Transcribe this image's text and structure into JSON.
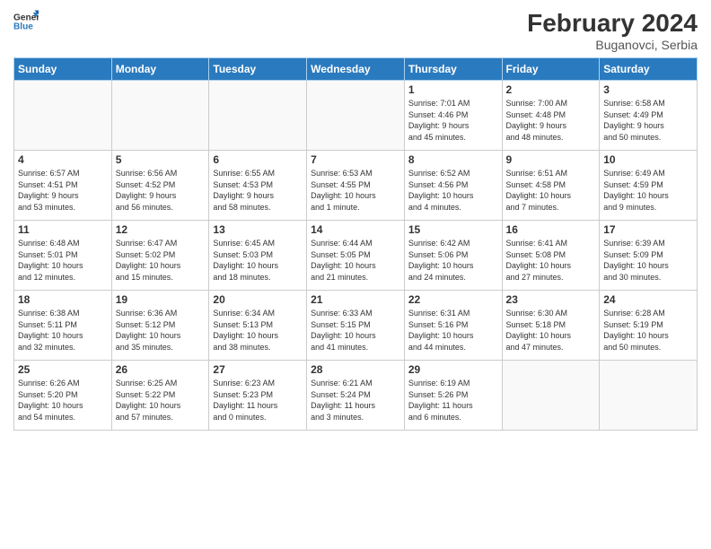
{
  "header": {
    "logo_text_general": "General",
    "logo_text_blue": "Blue",
    "month_year": "February 2024",
    "location": "Buganovci, Serbia"
  },
  "weekdays": [
    "Sunday",
    "Monday",
    "Tuesday",
    "Wednesday",
    "Thursday",
    "Friday",
    "Saturday"
  ],
  "weeks": [
    [
      {
        "day": "",
        "info": ""
      },
      {
        "day": "",
        "info": ""
      },
      {
        "day": "",
        "info": ""
      },
      {
        "day": "",
        "info": ""
      },
      {
        "day": "1",
        "info": "Sunrise: 7:01 AM\nSunset: 4:46 PM\nDaylight: 9 hours\nand 45 minutes."
      },
      {
        "day": "2",
        "info": "Sunrise: 7:00 AM\nSunset: 4:48 PM\nDaylight: 9 hours\nand 48 minutes."
      },
      {
        "day": "3",
        "info": "Sunrise: 6:58 AM\nSunset: 4:49 PM\nDaylight: 9 hours\nand 50 minutes."
      }
    ],
    [
      {
        "day": "4",
        "info": "Sunrise: 6:57 AM\nSunset: 4:51 PM\nDaylight: 9 hours\nand 53 minutes."
      },
      {
        "day": "5",
        "info": "Sunrise: 6:56 AM\nSunset: 4:52 PM\nDaylight: 9 hours\nand 56 minutes."
      },
      {
        "day": "6",
        "info": "Sunrise: 6:55 AM\nSunset: 4:53 PM\nDaylight: 9 hours\nand 58 minutes."
      },
      {
        "day": "7",
        "info": "Sunrise: 6:53 AM\nSunset: 4:55 PM\nDaylight: 10 hours\nand 1 minute."
      },
      {
        "day": "8",
        "info": "Sunrise: 6:52 AM\nSunset: 4:56 PM\nDaylight: 10 hours\nand 4 minutes."
      },
      {
        "day": "9",
        "info": "Sunrise: 6:51 AM\nSunset: 4:58 PM\nDaylight: 10 hours\nand 7 minutes."
      },
      {
        "day": "10",
        "info": "Sunrise: 6:49 AM\nSunset: 4:59 PM\nDaylight: 10 hours\nand 9 minutes."
      }
    ],
    [
      {
        "day": "11",
        "info": "Sunrise: 6:48 AM\nSunset: 5:01 PM\nDaylight: 10 hours\nand 12 minutes."
      },
      {
        "day": "12",
        "info": "Sunrise: 6:47 AM\nSunset: 5:02 PM\nDaylight: 10 hours\nand 15 minutes."
      },
      {
        "day": "13",
        "info": "Sunrise: 6:45 AM\nSunset: 5:03 PM\nDaylight: 10 hours\nand 18 minutes."
      },
      {
        "day": "14",
        "info": "Sunrise: 6:44 AM\nSunset: 5:05 PM\nDaylight: 10 hours\nand 21 minutes."
      },
      {
        "day": "15",
        "info": "Sunrise: 6:42 AM\nSunset: 5:06 PM\nDaylight: 10 hours\nand 24 minutes."
      },
      {
        "day": "16",
        "info": "Sunrise: 6:41 AM\nSunset: 5:08 PM\nDaylight: 10 hours\nand 27 minutes."
      },
      {
        "day": "17",
        "info": "Sunrise: 6:39 AM\nSunset: 5:09 PM\nDaylight: 10 hours\nand 30 minutes."
      }
    ],
    [
      {
        "day": "18",
        "info": "Sunrise: 6:38 AM\nSunset: 5:11 PM\nDaylight: 10 hours\nand 32 minutes."
      },
      {
        "day": "19",
        "info": "Sunrise: 6:36 AM\nSunset: 5:12 PM\nDaylight: 10 hours\nand 35 minutes."
      },
      {
        "day": "20",
        "info": "Sunrise: 6:34 AM\nSunset: 5:13 PM\nDaylight: 10 hours\nand 38 minutes."
      },
      {
        "day": "21",
        "info": "Sunrise: 6:33 AM\nSunset: 5:15 PM\nDaylight: 10 hours\nand 41 minutes."
      },
      {
        "day": "22",
        "info": "Sunrise: 6:31 AM\nSunset: 5:16 PM\nDaylight: 10 hours\nand 44 minutes."
      },
      {
        "day": "23",
        "info": "Sunrise: 6:30 AM\nSunset: 5:18 PM\nDaylight: 10 hours\nand 47 minutes."
      },
      {
        "day": "24",
        "info": "Sunrise: 6:28 AM\nSunset: 5:19 PM\nDaylight: 10 hours\nand 50 minutes."
      }
    ],
    [
      {
        "day": "25",
        "info": "Sunrise: 6:26 AM\nSunset: 5:20 PM\nDaylight: 10 hours\nand 54 minutes."
      },
      {
        "day": "26",
        "info": "Sunrise: 6:25 AM\nSunset: 5:22 PM\nDaylight: 10 hours\nand 57 minutes."
      },
      {
        "day": "27",
        "info": "Sunrise: 6:23 AM\nSunset: 5:23 PM\nDaylight: 11 hours\nand 0 minutes."
      },
      {
        "day": "28",
        "info": "Sunrise: 6:21 AM\nSunset: 5:24 PM\nDaylight: 11 hours\nand 3 minutes."
      },
      {
        "day": "29",
        "info": "Sunrise: 6:19 AM\nSunset: 5:26 PM\nDaylight: 11 hours\nand 6 minutes."
      },
      {
        "day": "",
        "info": ""
      },
      {
        "day": "",
        "info": ""
      }
    ]
  ]
}
